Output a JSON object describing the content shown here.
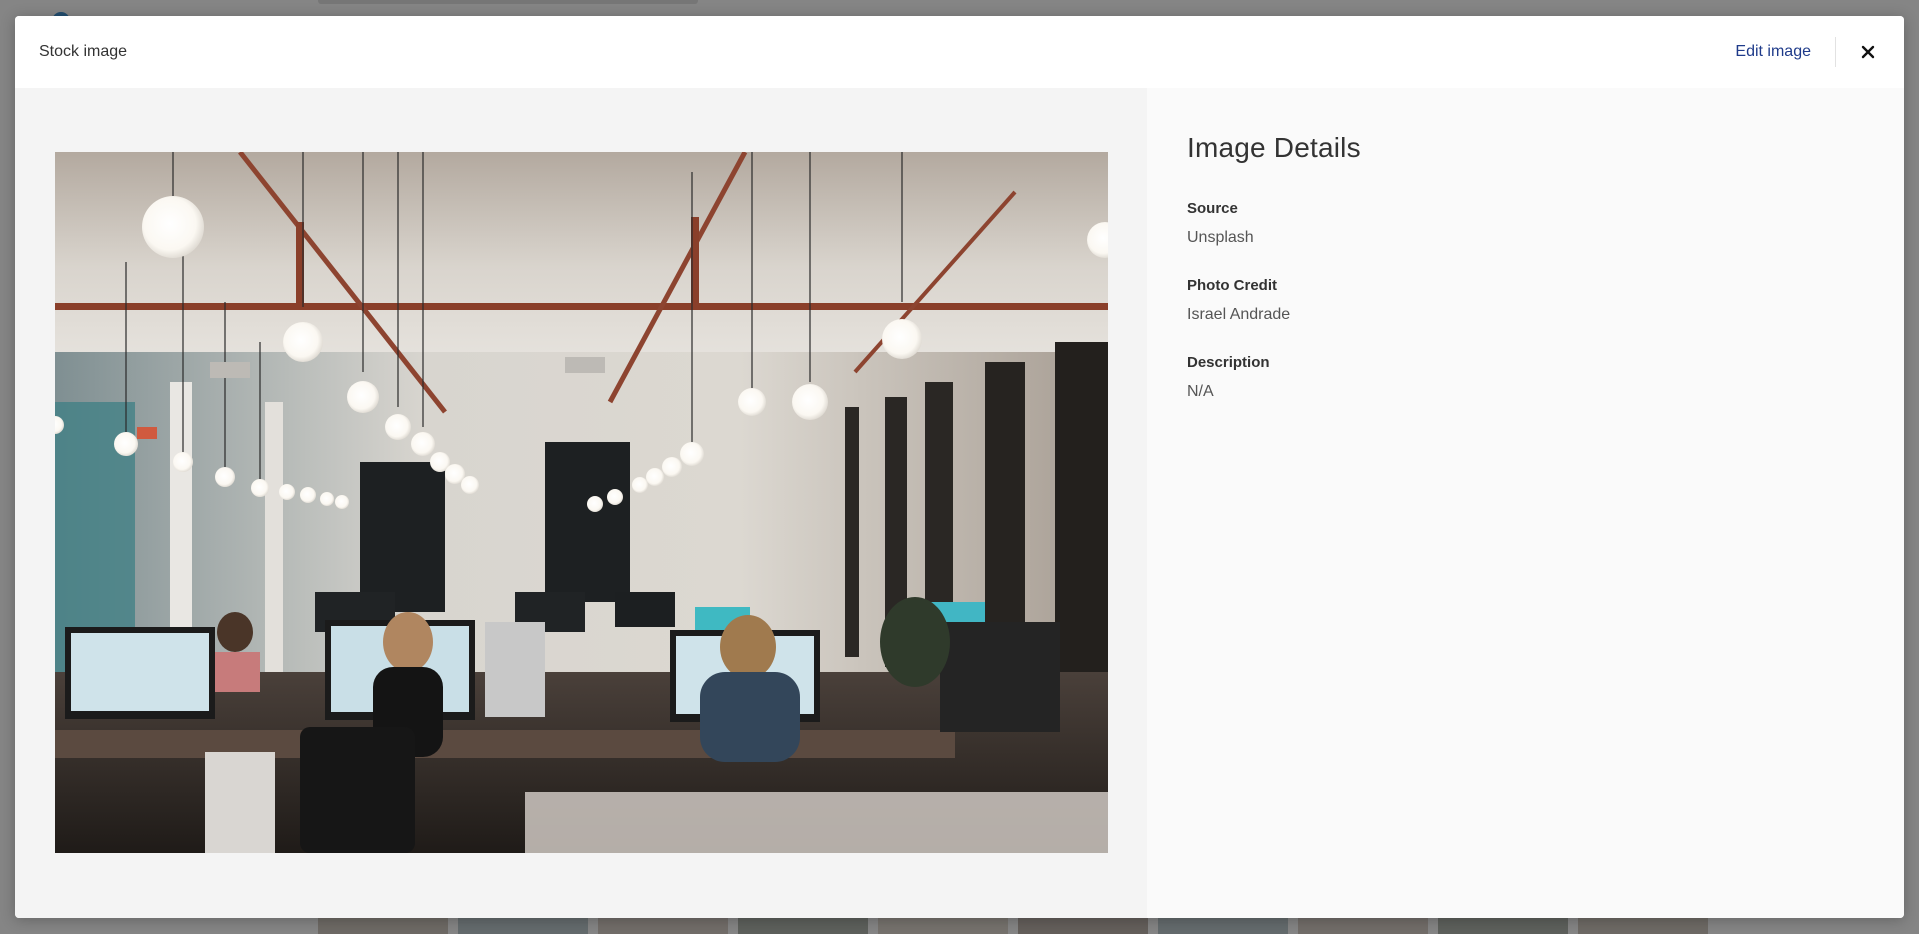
{
  "modal": {
    "title": "Stock image",
    "edit_label": "Edit image",
    "close_icon": "close-icon"
  },
  "image": {
    "icon": "office-photo"
  },
  "details": {
    "title": "Image Details",
    "fields": [
      {
        "label": "Source",
        "value": "Unsplash"
      },
      {
        "label": "Photo Credit",
        "value": "Israel Andrade"
      },
      {
        "label": "Description",
        "value": "N/A"
      }
    ]
  },
  "colors": {
    "link": "#1f3b8a",
    "header_bg": "#ffffff",
    "image_pane_bg": "#f4f4f4",
    "details_pane_bg": "#fafafa"
  }
}
